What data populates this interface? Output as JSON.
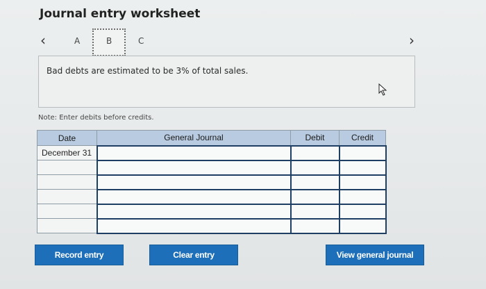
{
  "worksheet": {
    "title": "Journal entry worksheet",
    "tabs": [
      "A",
      "B",
      "C"
    ],
    "info_text": "Bad debts are estimated to be 3% of total sales.",
    "note": "Note: Enter debits before credits."
  },
  "table": {
    "headers": [
      "Date",
      "General Journal",
      "Debit",
      "Credit"
    ],
    "rows": [
      {
        "date": "December 31",
        "account": "",
        "debit": "",
        "credit": ""
      },
      {
        "date": "",
        "account": "",
        "debit": "",
        "credit": ""
      },
      {
        "date": "",
        "account": "",
        "debit": "",
        "credit": ""
      },
      {
        "date": "",
        "account": "",
        "debit": "",
        "credit": ""
      },
      {
        "date": "",
        "account": "",
        "debit": "",
        "credit": ""
      },
      {
        "date": "",
        "account": "",
        "debit": "",
        "credit": ""
      }
    ]
  },
  "buttons": {
    "record": "Record entry",
    "clear": "Clear entry",
    "view": "View general journal"
  },
  "icons": {
    "prev": "chevron-left-icon",
    "next": "chevron-right-icon",
    "cursor": "mouse-pointer-icon"
  },
  "colors": {
    "header_bg": "#b8cbe0",
    "button_bg": "#1c6fb8",
    "input_border": "#1e3f63"
  }
}
